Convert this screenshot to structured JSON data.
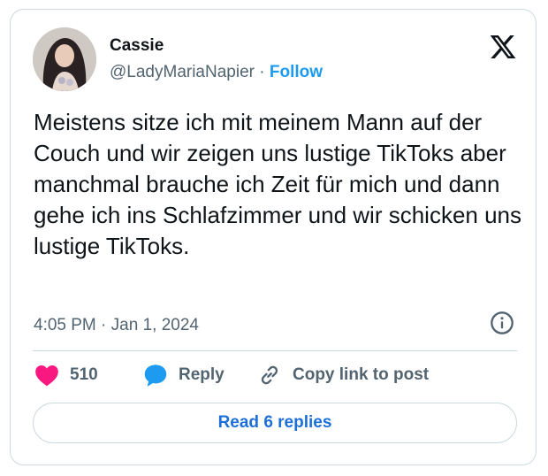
{
  "tweet": {
    "author_name": "Cassie",
    "handle": "@LadyMariaNapier",
    "separator": "·",
    "follow_label": "Follow",
    "body": "Meistens sitze ich mit meinem  Mann auf der Couch und wir zeigen uns lustige TikToks aber manchmal brauche ich Zeit für mich und dann gehe ich ins Schlafzimmer und wir schicken uns lustige TikToks.",
    "time": "4:05 PM",
    "time_separator": "·",
    "date": "Jan 1, 2024"
  },
  "actions": {
    "like_count": "510",
    "reply_label": "Reply",
    "copy_label": "Copy link to post"
  },
  "read_replies_label": "Read 6 replies",
  "icons": {
    "brand": "x-logo-icon",
    "info": "info-icon",
    "like": "heart-icon",
    "reply": "reply-bubble-icon",
    "copy": "link-icon"
  },
  "colors": {
    "accent": "#1d9bf0",
    "heart": "#f91880",
    "muted": "#536471",
    "border": "#cfd9de"
  }
}
